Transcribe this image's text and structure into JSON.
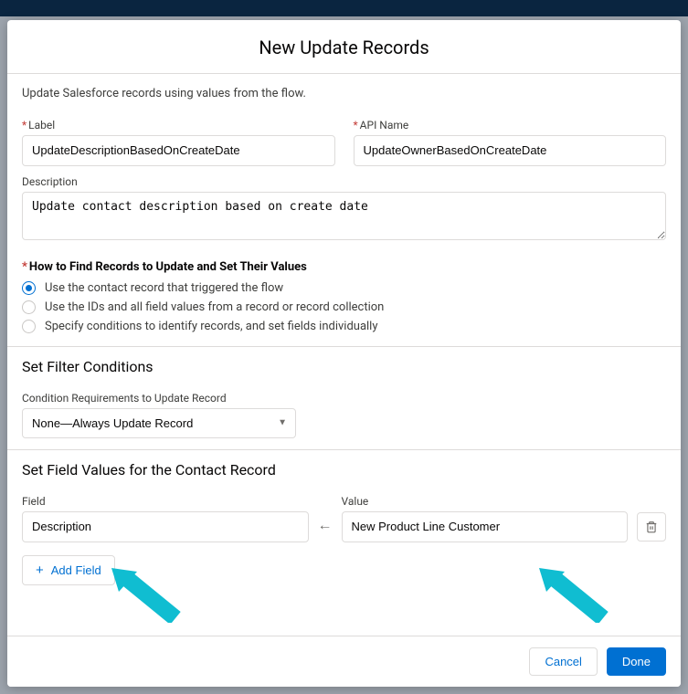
{
  "modal": {
    "title": "New Update Records",
    "intro": "Update Salesforce records using values from the flow."
  },
  "fields": {
    "label_field_label": "Label",
    "label_value": "UpdateDescriptionBasedOnCreateDate",
    "api_name_label": "API Name",
    "api_name_value": "UpdateOwnerBasedOnCreateDate",
    "description_label": "Description",
    "description_value": "Update contact description based on create date"
  },
  "find": {
    "heading": "How to Find Records to Update and Set Their Values",
    "options": [
      "Use the contact record that triggered the flow",
      "Use the IDs and all field values from a record or record collection",
      "Specify conditions to identify records, and set fields individually"
    ]
  },
  "filter": {
    "heading": "Set Filter Conditions",
    "requirement_label": "Condition Requirements to Update Record",
    "requirement_value": "None—Always Update Record"
  },
  "setvalues": {
    "heading": "Set Field Values for the Contact Record",
    "field_label": "Field",
    "value_label": "Value",
    "field_value": "Description",
    "value_value": "New Product Line Customer",
    "add_label": "Add Field"
  },
  "footer": {
    "cancel": "Cancel",
    "done": "Done"
  }
}
